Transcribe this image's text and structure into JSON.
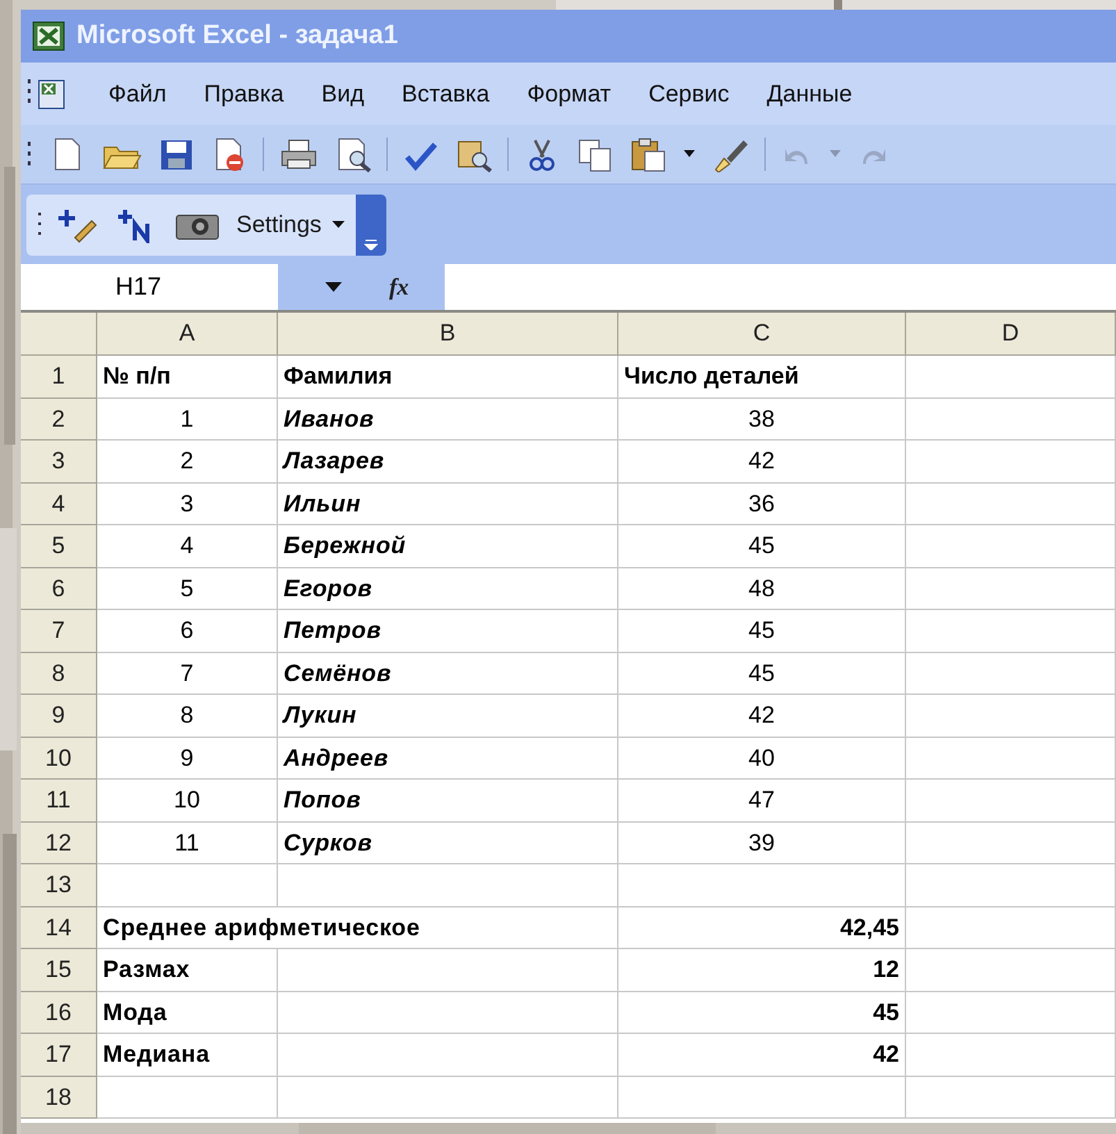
{
  "window": {
    "title": "Microsoft Excel - задача1"
  },
  "menu": [
    "Файл",
    "Правка",
    "Вид",
    "Вставка",
    "Формат",
    "Сервис",
    "Данные"
  ],
  "toolbar2": {
    "settings_button": "Settings"
  },
  "formula_bar": {
    "name_box": "H17",
    "fx": "fx"
  },
  "columns": [
    "A",
    "B",
    "C",
    "D"
  ],
  "rows": [
    {
      "number": "1",
      "kind": "header",
      "cells": [
        "№ п/п",
        "Фамилия",
        "Число деталей"
      ]
    },
    {
      "number": "2",
      "kind": "record",
      "cells": [
        "1",
        "Иванов",
        "38"
      ]
    },
    {
      "number": "3",
      "kind": "record",
      "cells": [
        "2",
        "Лазарев",
        "42"
      ]
    },
    {
      "number": "4",
      "kind": "record",
      "cells": [
        "3",
        "Ильин",
        "36"
      ]
    },
    {
      "number": "5",
      "kind": "record",
      "cells": [
        "4",
        "Бережной",
        "45"
      ]
    },
    {
      "number": "6",
      "kind": "record",
      "cells": [
        "5",
        "Егоров",
        "48"
      ]
    },
    {
      "number": "7",
      "kind": "record",
      "cells": [
        "6",
        "Петров",
        "45"
      ]
    },
    {
      "number": "8",
      "kind": "record",
      "cells": [
        "7",
        "Семёнов",
        "45"
      ]
    },
    {
      "number": "9",
      "kind": "record",
      "cells": [
        "8",
        "Лукин",
        "42"
      ]
    },
    {
      "number": "10",
      "kind": "record",
      "cells": [
        "9",
        "Андреев",
        "40"
      ]
    },
    {
      "number": "11",
      "kind": "record",
      "cells": [
        "10",
        "Попов",
        "47"
      ]
    },
    {
      "number": "12",
      "kind": "record",
      "cells": [
        "11",
        "Сурков",
        "39"
      ]
    },
    {
      "number": "13",
      "kind": "blank",
      "cells": []
    },
    {
      "number": "14",
      "kind": "stat_wide",
      "cells": [
        "Среднее арифметическое",
        "42,45"
      ]
    },
    {
      "number": "15",
      "kind": "stat",
      "cells": [
        "Размах",
        "12"
      ]
    },
    {
      "number": "16",
      "kind": "stat",
      "cells": [
        "Мода",
        "45"
      ]
    },
    {
      "number": "17",
      "kind": "stat",
      "cells": [
        "Медиана",
        "42"
      ]
    },
    {
      "number": "18",
      "kind": "blank",
      "cells": []
    }
  ]
}
